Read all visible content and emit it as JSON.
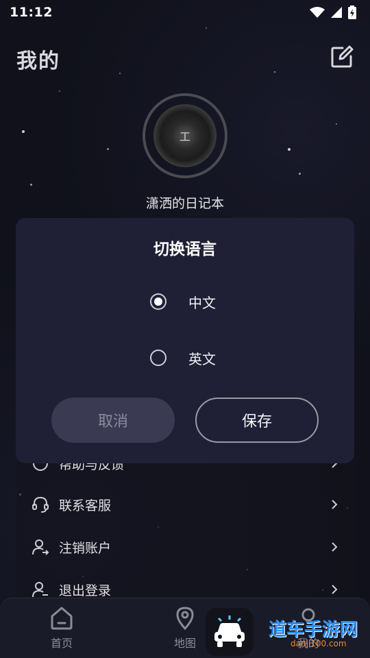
{
  "status_bar": {
    "time": "11:12"
  },
  "header": {
    "title": "我的"
  },
  "profile": {
    "username": "潇洒的日记本",
    "avatar_text": "工"
  },
  "menu": {
    "items": [
      {
        "label": "帮助与反馈",
        "icon": "help-icon"
      },
      {
        "label": "联系客服",
        "icon": "headset-icon"
      },
      {
        "label": "注销账户",
        "icon": "user-remove-icon"
      },
      {
        "label": "退出登录",
        "icon": "user-logout-icon"
      }
    ]
  },
  "dialog": {
    "title": "切换语言",
    "options": [
      {
        "label": "中文",
        "selected": true
      },
      {
        "label": "英文",
        "selected": false
      }
    ],
    "cancel_label": "取消",
    "save_label": "保存"
  },
  "bottom_nav": {
    "items": [
      {
        "label": "首页",
        "icon": "home-icon"
      },
      {
        "label": "地图",
        "icon": "map-pin-icon"
      },
      {
        "label": "",
        "icon": "car-icon"
      },
      {
        "label": "我的",
        "icon": "user-icon"
      }
    ]
  },
  "watermark": {
    "title": "道车手游网",
    "url": "danji100.com"
  },
  "colors": {
    "background": "#10111a",
    "dialog": "#1f2035",
    "cancel_button": "#3a3b52",
    "watermark_blue": "#2a8df0"
  }
}
